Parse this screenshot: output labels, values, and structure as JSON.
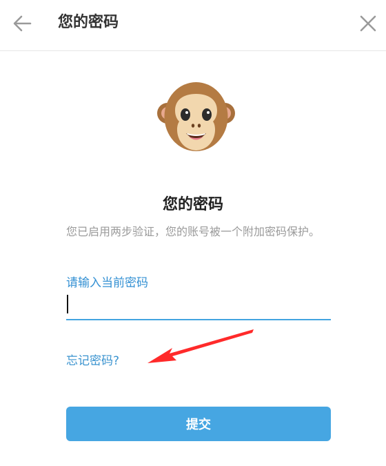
{
  "header": {
    "title": "您的密码",
    "back_icon": "arrow-left-icon",
    "close_icon": "close-icon"
  },
  "illustration": {
    "icon": "monkey-face-icon"
  },
  "main": {
    "title": "您的密码",
    "description": "您已启用两步验证，您的账号被一个附加密码保护。"
  },
  "form": {
    "label": "请输入当前密码",
    "password_value": "",
    "forgot_link": "忘记密码?",
    "submit_label": "提交"
  },
  "annotation": {
    "icon": "red-arrow-icon",
    "color": "#ff2a2a"
  },
  "colors": {
    "accent": "#42a4e0",
    "link": "#3a93cf",
    "submit": "#46a6e2"
  }
}
